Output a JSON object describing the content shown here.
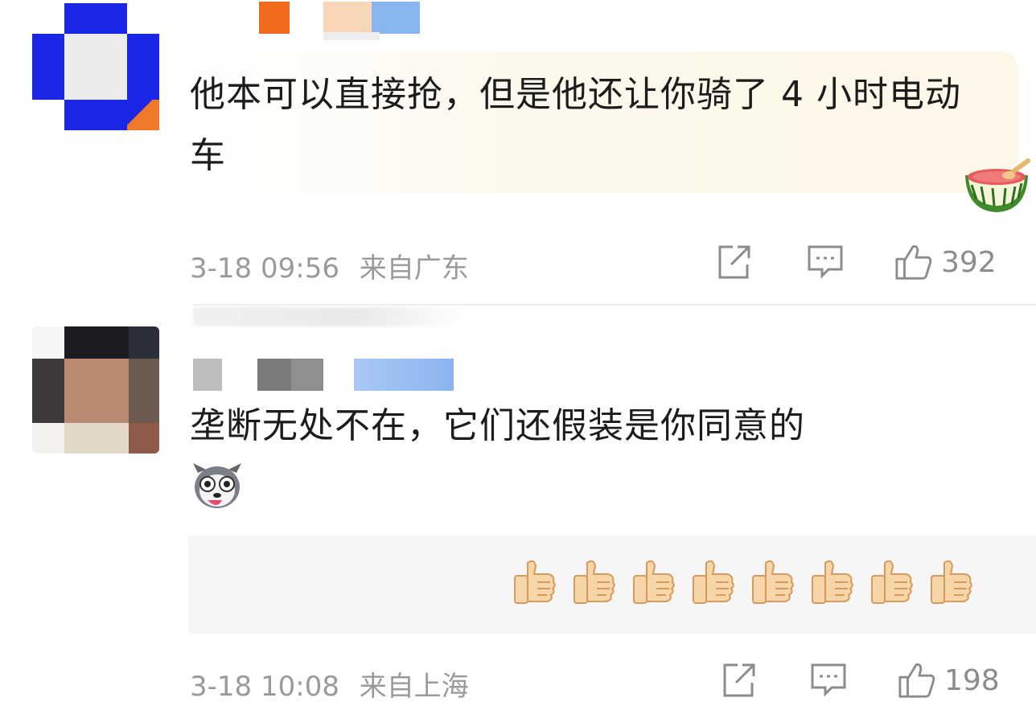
{
  "comments": [
    {
      "text": "他本可以直接抢，但是他还让你骑了 4 小时电动车",
      "time": "3-18 09:56",
      "location": "来自广东",
      "likes": "392",
      "trailing_emoji": "watermelon-emoji",
      "avatar_blocks": [
        "#ffffff",
        "#1a27e6",
        "#ffffff",
        "#1a27e6",
        "#ececec",
        "#1a27e6",
        "#ffffff",
        "#1a27e6",
        "#f07a2a"
      ],
      "name_blocks": [
        "#f26b1c",
        "#f8d6b8",
        "#8ab6f0"
      ]
    },
    {
      "text": "垄断无处不在，它们还假装是你同意的",
      "time": "3-18 10:08",
      "location": "来自上海",
      "likes": "198",
      "leading_emoji": "husky-emoji",
      "sticker": "thumbs-up-emoji",
      "sticker_count": 8,
      "avatar_blocks": [
        "#ffffff",
        "#1b1b22",
        "#2a2f3a",
        "#3e3a3c",
        "#b98a70",
        "#c7a08c",
        "#5b4c4a",
        "#c69378",
        "#8f5a4a"
      ],
      "name_blocks": [
        "#bdbdbd",
        "#7a7a7a",
        "#8ab4f0"
      ]
    }
  ],
  "icons": {
    "share": "share-icon",
    "comment": "comment-icon",
    "like": "thumb-up-icon"
  },
  "colors": {
    "meta_text": "#9a9a9a",
    "highlight_bg": "#fcf7e8"
  }
}
